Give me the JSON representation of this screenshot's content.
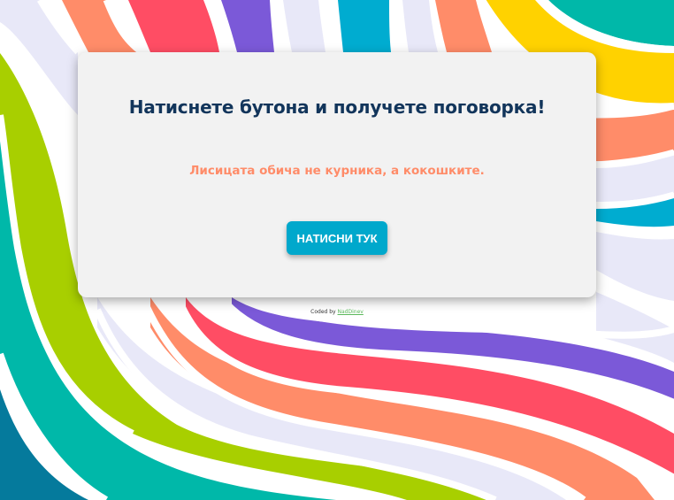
{
  "card": {
    "title": "Натиснете бутона и получете поговорка!",
    "proverb": "Лисицата обича не курника, а кокошките.",
    "button_label": "НАТИСНИ ТУК"
  },
  "footer": {
    "coded_by": "Coded by",
    "author": "NadDinev"
  },
  "colors": {
    "title": "#12355b",
    "proverb": "#ff8c69",
    "button": "#00a8cc",
    "card_background": "#f2f2f2",
    "stripe_teal_dark": "#057a9c",
    "stripe_teal": "#00b8a9",
    "stripe_lime": "#a8cf00",
    "stripe_lavender": "#e8e8f8",
    "stripe_orange": "#ff8c69",
    "stripe_red": "#ff4d64",
    "stripe_purple": "#7b59d8",
    "stripe_cyan": "#00acd0",
    "stripe_yellow": "#ffd200"
  }
}
